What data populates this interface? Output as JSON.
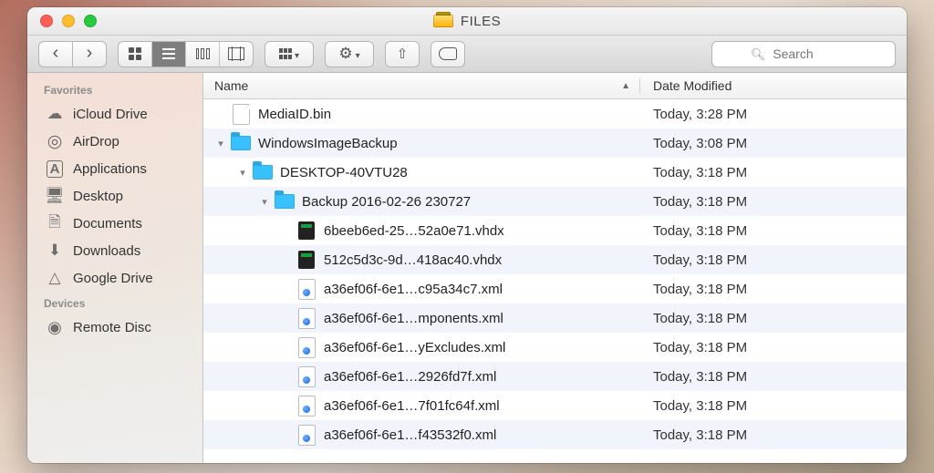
{
  "window": {
    "title": "FILES"
  },
  "toolbar": {
    "search_placeholder": "Search"
  },
  "sidebar": {
    "headers": {
      "favorites": "Favorites",
      "devices": "Devices"
    },
    "favorites": [
      {
        "label": "iCloud Drive",
        "icon": "cloud-icon"
      },
      {
        "label": "AirDrop",
        "icon": "airdrop-icon"
      },
      {
        "label": "Applications",
        "icon": "applications-icon"
      },
      {
        "label": "Desktop",
        "icon": "desktop-icon"
      },
      {
        "label": "Documents",
        "icon": "documents-icon"
      },
      {
        "label": "Downloads",
        "icon": "downloads-icon"
      },
      {
        "label": "Google Drive",
        "icon": "google-drive-icon"
      }
    ],
    "devices": [
      {
        "label": "Remote Disc",
        "icon": "remote-disc-icon"
      }
    ]
  },
  "columns": {
    "name": "Name",
    "date": "Date Modified",
    "sort": "name_asc"
  },
  "rows": [
    {
      "indent": 0,
      "disclosure": "",
      "kind": "file",
      "name": "MediaID.bin",
      "date": "Today, 3:28 PM"
    },
    {
      "indent": 0,
      "disclosure": "open",
      "kind": "folder",
      "name": "WindowsImageBackup",
      "date": "Today, 3:08 PM"
    },
    {
      "indent": 1,
      "disclosure": "open",
      "kind": "folder",
      "name": "DESKTOP-40VTU28",
      "date": "Today, 3:18 PM"
    },
    {
      "indent": 2,
      "disclosure": "open",
      "kind": "folder",
      "name": "Backup 2016-02-26 230727",
      "date": "Today, 3:18 PM"
    },
    {
      "indent": 3,
      "disclosure": "",
      "kind": "disk",
      "name": "6beeb6ed-25…52a0e71.vhdx",
      "date": "Today, 3:18 PM"
    },
    {
      "indent": 3,
      "disclosure": "",
      "kind": "disk",
      "name": "512c5d3c-9d…418ac40.vhdx",
      "date": "Today, 3:18 PM"
    },
    {
      "indent": 3,
      "disclosure": "",
      "kind": "xml",
      "name": "a36ef06f-6e1…c95a34c7.xml",
      "date": "Today, 3:18 PM"
    },
    {
      "indent": 3,
      "disclosure": "",
      "kind": "xml",
      "name": "a36ef06f-6e1…mponents.xml",
      "date": "Today, 3:18 PM"
    },
    {
      "indent": 3,
      "disclosure": "",
      "kind": "xml",
      "name": "a36ef06f-6e1…yExcludes.xml",
      "date": "Today, 3:18 PM"
    },
    {
      "indent": 3,
      "disclosure": "",
      "kind": "xml",
      "name": "a36ef06f-6e1…2926fd7f.xml",
      "date": "Today, 3:18 PM"
    },
    {
      "indent": 3,
      "disclosure": "",
      "kind": "xml",
      "name": "a36ef06f-6e1…7f01fc64f.xml",
      "date": "Today, 3:18 PM"
    },
    {
      "indent": 3,
      "disclosure": "",
      "kind": "xml",
      "name": "a36ef06f-6e1…f43532f0.xml",
      "date": "Today, 3:18 PM"
    }
  ]
}
